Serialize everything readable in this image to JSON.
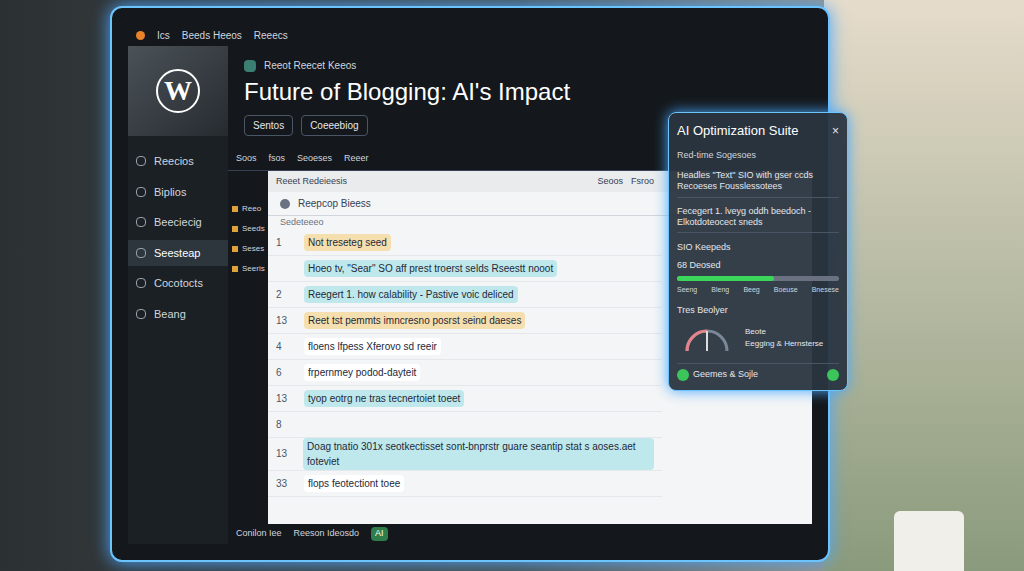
{
  "top_bar": {
    "items": [
      "Ics",
      "Beeds Heeos",
      "Reeecs"
    ]
  },
  "sidebar": {
    "logo": "W",
    "items": [
      {
        "label": "Reecios",
        "selected": false
      },
      {
        "label": "Biplios",
        "selected": false
      },
      {
        "label": "Beeciecig",
        "selected": false
      },
      {
        "label": "Seesteap",
        "selected": true
      },
      {
        "label": "Cocotocts",
        "selected": false
      },
      {
        "label": "Beang",
        "selected": false
      }
    ]
  },
  "header": {
    "breadcrumb": "Reeot Reecet Keeos",
    "title": "Future of Blogging: AI's Impact",
    "buttons": [
      "Sentos",
      "Coeeebiog"
    ]
  },
  "toolbar": {
    "items": [
      "Soos",
      "fsos",
      "Seoeses",
      "Reeer"
    ],
    "subtitle": "Reeet Redeieesis",
    "right": [
      "Seoos",
      "Fsroo"
    ]
  },
  "file_list": {
    "items": [
      "Reeo",
      "Seeds",
      "Seses",
      "Seeris"
    ]
  },
  "editor": {
    "title": "Reepcop Bieess",
    "subtitle": "Sedeteeeo",
    "lines": [
      {
        "number": "1",
        "text": "Not treseteg seed",
        "color": "#f6dfae"
      },
      {
        "number": "",
        "text": "Hoeo tv, \"Sear\" SO aff prest troerst selds Rseestt nooot",
        "color": "#bfe8ec"
      },
      {
        "number": "2",
        "text": "Reegert 1. how calability - Pastive voic deliced",
        "color": "#bfe8ec"
      },
      {
        "number": "13",
        "text": "Reet tst pemmts imncresno posrst seind daeses",
        "color": "#f6dfae"
      },
      {
        "number": "4",
        "text": "floens lfpess Xferovo sd reeir",
        "color": "#ffffff"
      },
      {
        "number": "6",
        "text": "frpernmey podod-dayteit",
        "color": "#ffffff"
      },
      {
        "number": "13",
        "text": "tyop eotrg ne tras tecnertoiet toeet",
        "color": "#bfe8ec"
      },
      {
        "number": "8",
        "text": "",
        "color": "#ffffff"
      },
      {
        "number": "13",
        "text": "Doag tnatio 301x seotkectisset sont-bnprstr guare seantip stat s aoses.aet foteviet",
        "color": "#bfe8ec"
      },
      {
        "number": "33",
        "text": "flops feotectiont toee",
        "color": "#ffffff"
      }
    ]
  },
  "footer": {
    "items": [
      "Conilon Iee",
      "Reeson Ideosdo"
    ],
    "badge": "AI"
  },
  "ai_panel": {
    "title": "AI Optimization Suite",
    "close": "×",
    "section": "Red-time Sogesoes",
    "suggestions": [
      "Headles \"Text\" SIO with gser ccds Recoeses Fousslessotees",
      "Fecegert 1. lveyg oddh beedoch - Elkotdoteocect sneds"
    ],
    "keywords": {
      "title": "SIO Keepeds",
      "reading": "68 Deosed",
      "level": 0.6,
      "labels": [
        "Seeng",
        "Bleng",
        "Beeg",
        "Boeuse",
        "Bnesese"
      ]
    },
    "tone": {
      "title": "Tres Beolyer",
      "level": 0.5,
      "labels": [
        "Beote",
        "Eegging & Hernsterse"
      ]
    },
    "footer": {
      "label": "Geemes & Sojle",
      "checked": true,
      "done": true
    }
  }
}
